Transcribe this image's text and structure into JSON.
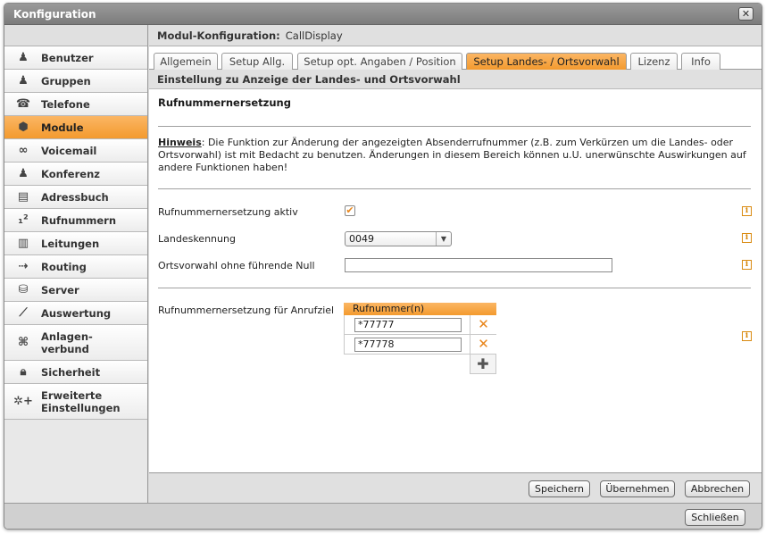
{
  "window": {
    "title": "Konfiguration",
    "close_glyph": "✕"
  },
  "sidebar": {
    "items": [
      {
        "label": "Benutzer",
        "icon": "user-icon",
        "glyph": "♟"
      },
      {
        "label": "Gruppen",
        "icon": "group-icon",
        "glyph": "♟"
      },
      {
        "label": "Telefone",
        "icon": "phone-icon",
        "glyph": "☎"
      },
      {
        "label": "Module",
        "icon": "module-icon",
        "glyph": "⬢",
        "active": true
      },
      {
        "label": "Voicemail",
        "icon": "voicemail-icon",
        "glyph": "∞"
      },
      {
        "label": "Konferenz",
        "icon": "conference-icon",
        "glyph": "♟"
      },
      {
        "label": "Adressbuch",
        "icon": "addressbook-icon",
        "glyph": "▤"
      },
      {
        "label": "Rufnummern",
        "icon": "numbers-icon",
        "glyph": "₁²"
      },
      {
        "label": "Leitungen",
        "icon": "lines-icon",
        "glyph": "▥"
      },
      {
        "label": "Routing",
        "icon": "routing-icon",
        "glyph": "⇢"
      },
      {
        "label": "Server",
        "icon": "server-icon",
        "glyph": "⛁"
      },
      {
        "label": "Auswertung",
        "icon": "chart-icon",
        "glyph": "⟋"
      },
      {
        "label_line1": "Anlagen-",
        "label_line2": "verbund",
        "icon": "network-icon",
        "glyph": "⌘"
      },
      {
        "label": "Sicherheit",
        "icon": "lock-icon",
        "glyph": "🔒︎"
      },
      {
        "label_line1": "Erweiterte",
        "label_line2": "Einstellungen",
        "icon": "gears-icon",
        "glyph": "✲+"
      }
    ]
  },
  "module_header": {
    "label": "Modul-Konfiguration:",
    "value": "CallDisplay"
  },
  "tabs": [
    {
      "label": "Allgemein"
    },
    {
      "label": "Setup Allg."
    },
    {
      "label": "Setup opt. Angaben / Position"
    },
    {
      "label": "Setup Landes- / Ortsvorwahl",
      "active": true
    },
    {
      "label": "Lizenz"
    },
    {
      "label": "Info"
    }
  ],
  "section": {
    "title": "Einstellung zu Anzeige der Landes- und Ortsvorwahl"
  },
  "content": {
    "heading": "Rufnummernersetzung",
    "hint_keyword": "Hinweis",
    "hint_text": ": Die Funktion zur Änderung der angezeigten Absenderrufnummer (z.B. zum Verkürzen um die Landes- oder Ortsvorwahl) ist mit Bedacht zu benutzen. Änderungen in diesem Bereich können u.U. unerwünschte Auswirkungen auf andere Funktionen haben!",
    "active_label": "Rufnummernersetzung aktiv",
    "active_checked": true,
    "country_label": "Landeskennung",
    "country_value": "0049",
    "area_label": "Ortsvorwahl ohne führende Null",
    "area_value": "",
    "target_label": "Rufnummernersetzung für Anrufziel",
    "grid_header": "Rufnummer(n)",
    "numbers": [
      "*77777",
      "*77778"
    ],
    "info_glyph": "i",
    "delete_glyph": "✕",
    "add_glyph": "✚",
    "check_glyph": "✔"
  },
  "footer": {
    "save": "Speichern",
    "apply": "Übernehmen",
    "cancel": "Abbrechen"
  },
  "bottom": {
    "close": "Schließen"
  },
  "colors": {
    "accent": "#f39a2e",
    "info": "#d98a10"
  }
}
